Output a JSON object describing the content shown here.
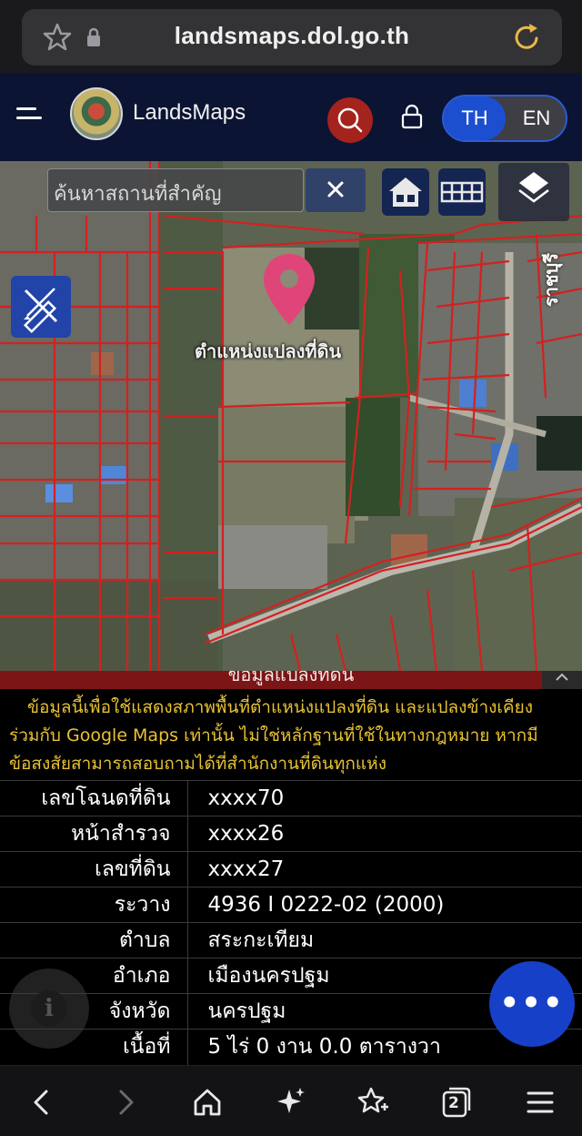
{
  "browser": {
    "url": "landsmaps.dol.go.th",
    "tab_count": "2"
  },
  "header": {
    "brand": "LandsMaps",
    "lang_th": "TH",
    "lang_en": "EN"
  },
  "map": {
    "search_placeholder": "ค้นหาสถานที่สำคัญ",
    "pin_label": "ตำแหน่งแปลงที่ดิน",
    "road_label": "ราชบุรี"
  },
  "panel": {
    "title": "ข้อมูลแปลงที่ดิน",
    "notice_lines": [
      "ข้อมูลนี้เพื่อใช้แสดงสภาพพื้นที่ตำแหน่งแปลงที่ดิน และแปลงข้างเคียง",
      "ร่วมกับ Google Maps เท่านั้น ไม่ใช่หลักฐานที่ใช้ในทางกฎหมาย หากมี",
      "ข้อสงสัยสามารถสอบถามได้ที่สำนักงานที่ดินทุกแห่ง"
    ],
    "rows": [
      {
        "label": "เลขโฉนดที่ดิน",
        "value": "xxxx70"
      },
      {
        "label": "หน้าสำรวจ",
        "value": "xxxx26"
      },
      {
        "label": "เลขที่ดิน",
        "value": "xxxx27"
      },
      {
        "label": "ระวาง",
        "value": "4936 I 0222-02 (2000)"
      },
      {
        "label": "ตำบล",
        "value": "สระกะเทียม"
      },
      {
        "label": "อำเภอ",
        "value": "เมืองนครปฐม"
      },
      {
        "label": "จังหวัด",
        "value": "นครปฐม"
      },
      {
        "label": "เนื้อที่",
        "value": "5 ไร่ 0 งาน 0.0 ตารางวา"
      }
    ],
    "fab_label": "•••",
    "info_icon": "i"
  },
  "colors": {
    "header_bg": "#0b1433",
    "parcel_line": "#d42020",
    "notice_text": "#e7c234",
    "fab": "#1640c8",
    "pin": "#e0457a"
  }
}
